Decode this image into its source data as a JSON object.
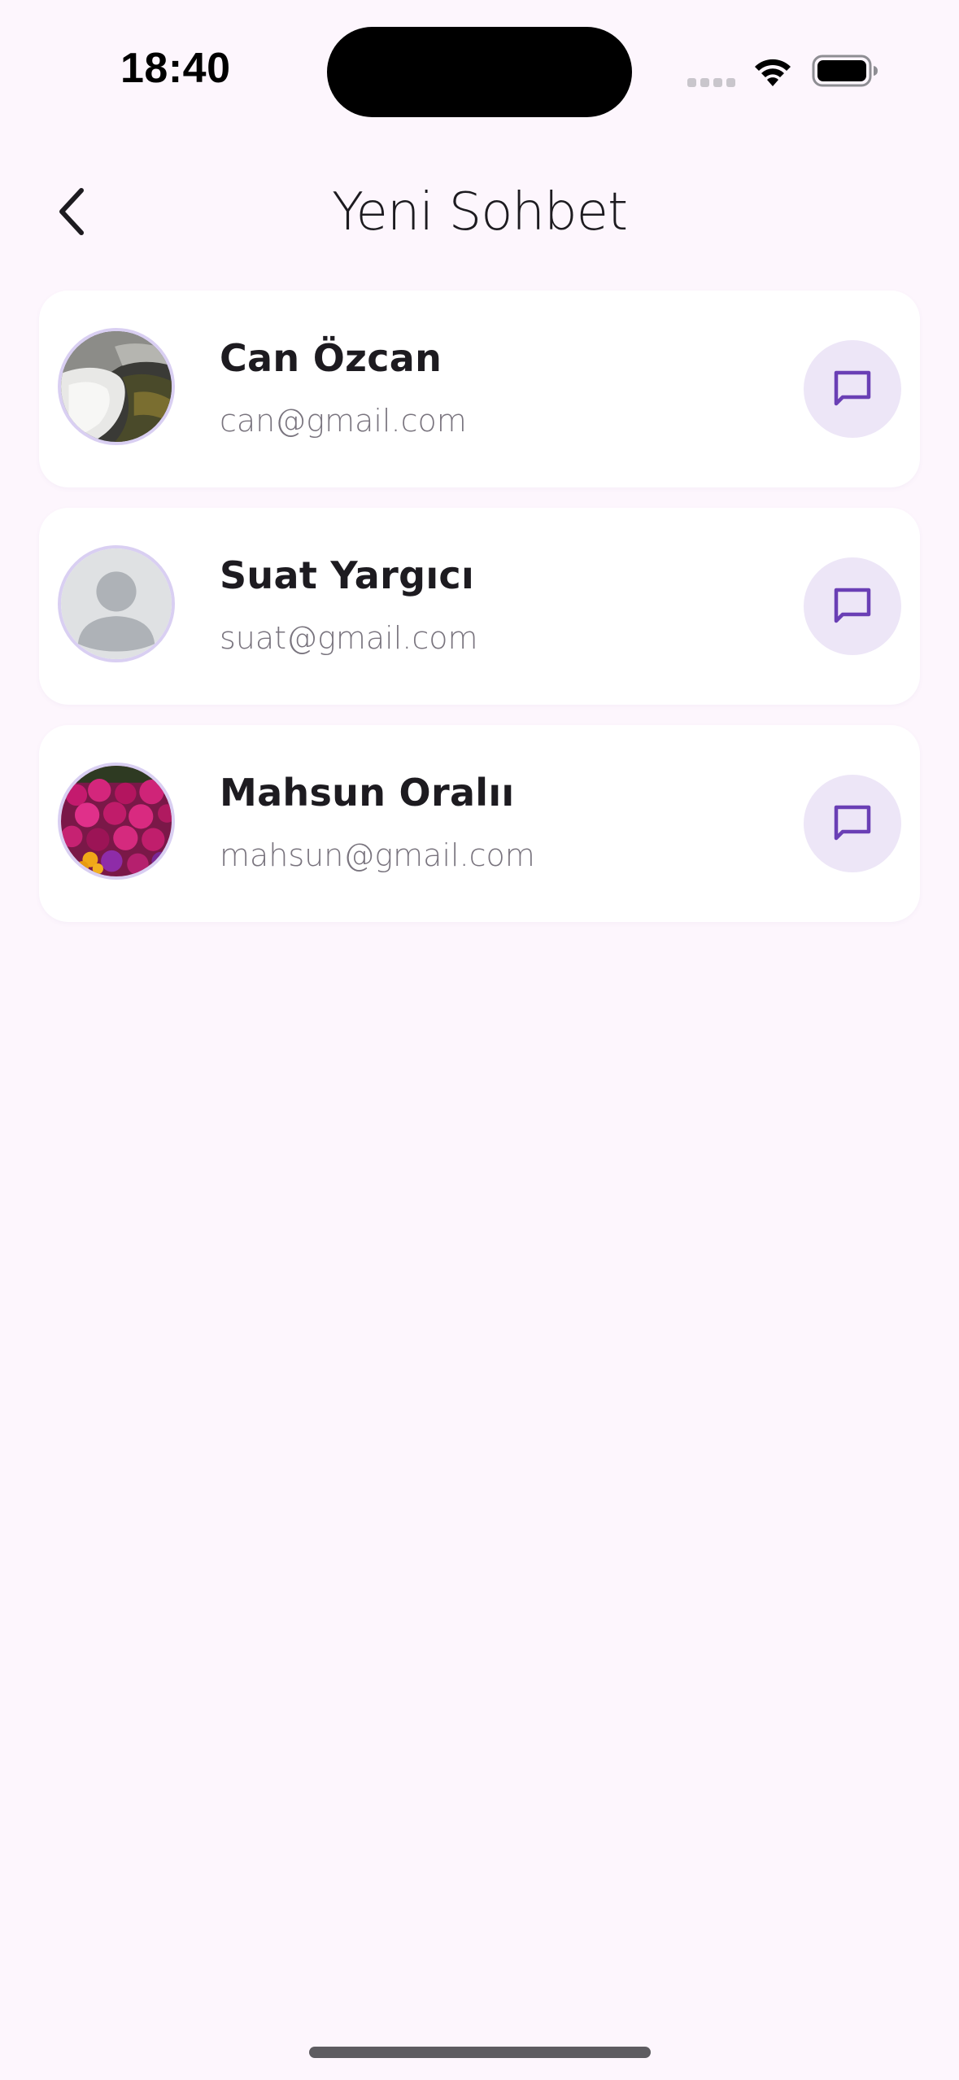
{
  "status_bar": {
    "time": "18:40",
    "signal_icon": "cellular-signal-icon",
    "wifi_icon": "wifi-icon",
    "battery_icon": "battery-full-icon"
  },
  "header": {
    "title": "Yeni Sohbet",
    "back_icon": "chevron-left-icon"
  },
  "contacts": [
    {
      "name": "Can Özcan",
      "email": "can@gmail.com",
      "avatar": "photo-waterfall",
      "action_icon": "message-icon"
    },
    {
      "name": "Suat Yargıcı",
      "email": "suat@gmail.com",
      "avatar": "placeholder-person",
      "action_icon": "message-icon"
    },
    {
      "name": "Mahsun Oralıı",
      "email": "mahsun@gmail.com",
      "avatar": "photo-flowers",
      "action_icon": "message-icon"
    }
  ],
  "colors": {
    "background": "#FDF6FD",
    "card": "#FFFFFF",
    "accent": "#6A3FB5",
    "action_bg": "#EDE6F7",
    "avatar_border": "#D9CFF2",
    "secondary_text": "#79747E"
  }
}
